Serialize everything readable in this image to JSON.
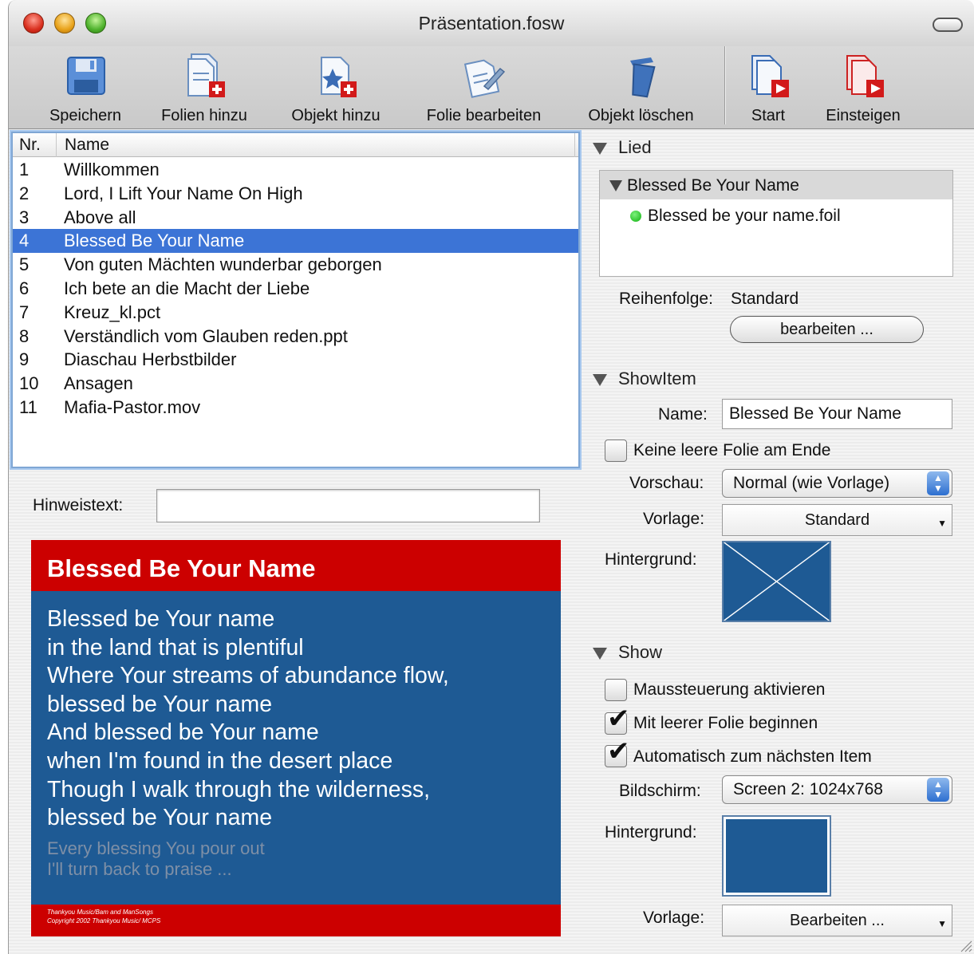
{
  "window": {
    "title": "Präsentation.fosw"
  },
  "toolbar": {
    "items": [
      {
        "label": "Speichern",
        "icon": "floppy-disk-icon"
      },
      {
        "label": "Folien hinzu",
        "icon": "add-slides-icon"
      },
      {
        "label": "Objekt hinzu",
        "icon": "add-object-icon"
      },
      {
        "label": "Folie bearbeiten",
        "icon": "edit-slide-icon"
      },
      {
        "label": "Objekt löschen",
        "icon": "trash-icon"
      },
      {
        "label": "Start",
        "icon": "start-show-icon"
      },
      {
        "label": "Einsteigen",
        "icon": "join-show-icon"
      }
    ]
  },
  "list": {
    "columns": {
      "nr": "Nr.",
      "name": "Name"
    },
    "rows": [
      {
        "nr": "1",
        "name": "Willkommen"
      },
      {
        "nr": "2",
        "name": "Lord, I Lift Your Name On High"
      },
      {
        "nr": "3",
        "name": "Above all"
      },
      {
        "nr": "4",
        "name": "Blessed Be Your Name",
        "selected": true
      },
      {
        "nr": "5",
        "name": "Von guten Mächten wunderbar geborgen"
      },
      {
        "nr": "6",
        "name": "Ich bete an die Macht der Liebe"
      },
      {
        "nr": "7",
        "name": "Kreuz_kl.pct"
      },
      {
        "nr": "8",
        "name": "Verständlich vom Glauben reden.ppt"
      },
      {
        "nr": "9",
        "name": "Diaschau Herbstbilder"
      },
      {
        "nr": "10",
        "name": "Ansagen"
      },
      {
        "nr": "11",
        "name": "Mafia-Pastor.mov"
      }
    ]
  },
  "hint": {
    "label": "Hinweistext:",
    "value": ""
  },
  "preview": {
    "title": "Blessed Be Your Name",
    "lines": [
      "Blessed be Your name",
      "in the land that is plentiful",
      "Where Your streams of abundance flow,",
      "blessed be Your name",
      "And blessed be Your name",
      "when I'm found in the desert place",
      "Though I walk through the wilderness,",
      "blessed be Your name"
    ],
    "faded_lines": [
      "Every blessing You pour out",
      "I'll turn back to praise ..."
    ],
    "footer_lines": [
      "Thankyou Music/Bam and ManSongs",
      "Copyright 2002 Thankyou Music/ MCPS"
    ],
    "colors": {
      "header": "#cc0000",
      "body": "#1e5a94"
    }
  },
  "lied": {
    "section_label": "Lied",
    "tree_head": "Blessed Be Your Name",
    "tree_item": "Blessed be your name.foil",
    "order_label": "Reihenfolge:",
    "order_value": "Standard",
    "edit_button": "bearbeiten ..."
  },
  "showitem": {
    "section_label": "ShowItem",
    "name_label": "Name:",
    "name_value": "Blessed Be Your Name",
    "no_empty_slide_label": "Keine leere Folie am Ende",
    "no_empty_slide_checked": false,
    "preview_label": "Vorschau:",
    "preview_value": "Normal (wie Vorlage)",
    "template_label": "Vorlage:",
    "template_value": "Standard",
    "background_label": "Hintergrund:"
  },
  "show": {
    "section_label": "Show",
    "mouse_label": "Maussteuerung aktivieren",
    "mouse_checked": false,
    "start_empty_label": "Mit leerer Folie beginnen",
    "start_empty_checked": true,
    "auto_next_label": "Automatisch zum nächsten Item",
    "auto_next_checked": true,
    "screen_label": "Bildschirm:",
    "screen_value": "Screen 2: 1024x768",
    "background_label": "Hintergrund:",
    "background_color": "#1e5a94",
    "template_label": "Vorlage:",
    "template_value": "Bearbeiten ..."
  }
}
